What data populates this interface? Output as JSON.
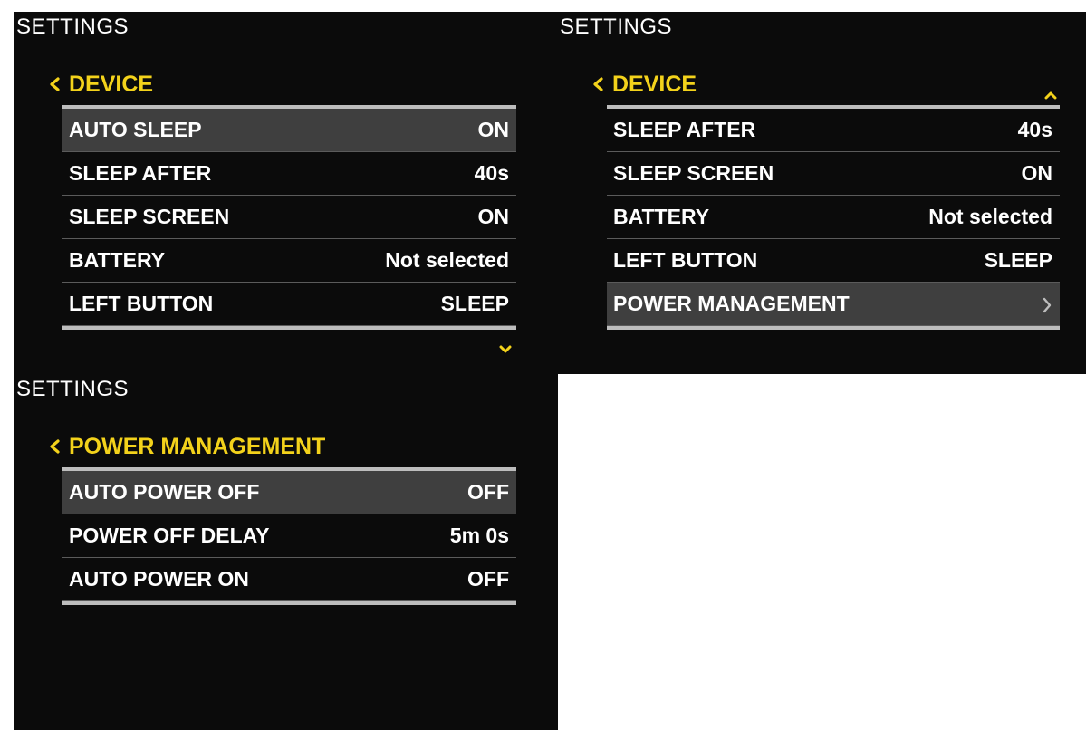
{
  "colors": {
    "accent": "#f3d21b",
    "panel_bg": "#0b0b0b",
    "selected_row": "#3f3f3f",
    "divider": "#bdbdbd"
  },
  "panels": [
    {
      "title": "SETTINGS",
      "back_label": "DEVICE",
      "scroll_indicator": "chevron-down-icon",
      "rows": [
        {
          "label": "AUTO SLEEP",
          "value": "ON",
          "selected": true
        },
        {
          "label": "SLEEP AFTER",
          "value": "40s"
        },
        {
          "label": "SLEEP SCREEN",
          "value": "ON"
        },
        {
          "label": "BATTERY",
          "value": "Not selected"
        },
        {
          "label": "LEFT BUTTON",
          "value": "SLEEP"
        }
      ]
    },
    {
      "title": "SETTINGS",
      "back_label": "DEVICE",
      "scroll_indicator": "chevron-up-icon",
      "rows": [
        {
          "label": "SLEEP AFTER",
          "value": "40s"
        },
        {
          "label": "SLEEP SCREEN",
          "value": "ON"
        },
        {
          "label": "BATTERY",
          "value": "Not selected"
        },
        {
          "label": "LEFT BUTTON",
          "value": "SLEEP"
        },
        {
          "label": "POWER MANAGEMENT",
          "icon": "chevron-right-icon",
          "selected": true
        }
      ]
    },
    {
      "title": "SETTINGS",
      "back_label": "POWER MANAGEMENT",
      "rows": [
        {
          "label": "AUTO POWER OFF",
          "value": "OFF",
          "selected": true
        },
        {
          "label": "POWER OFF DELAY",
          "value": "5m 0s"
        },
        {
          "label": "AUTO POWER ON",
          "value": "OFF"
        }
      ]
    }
  ]
}
